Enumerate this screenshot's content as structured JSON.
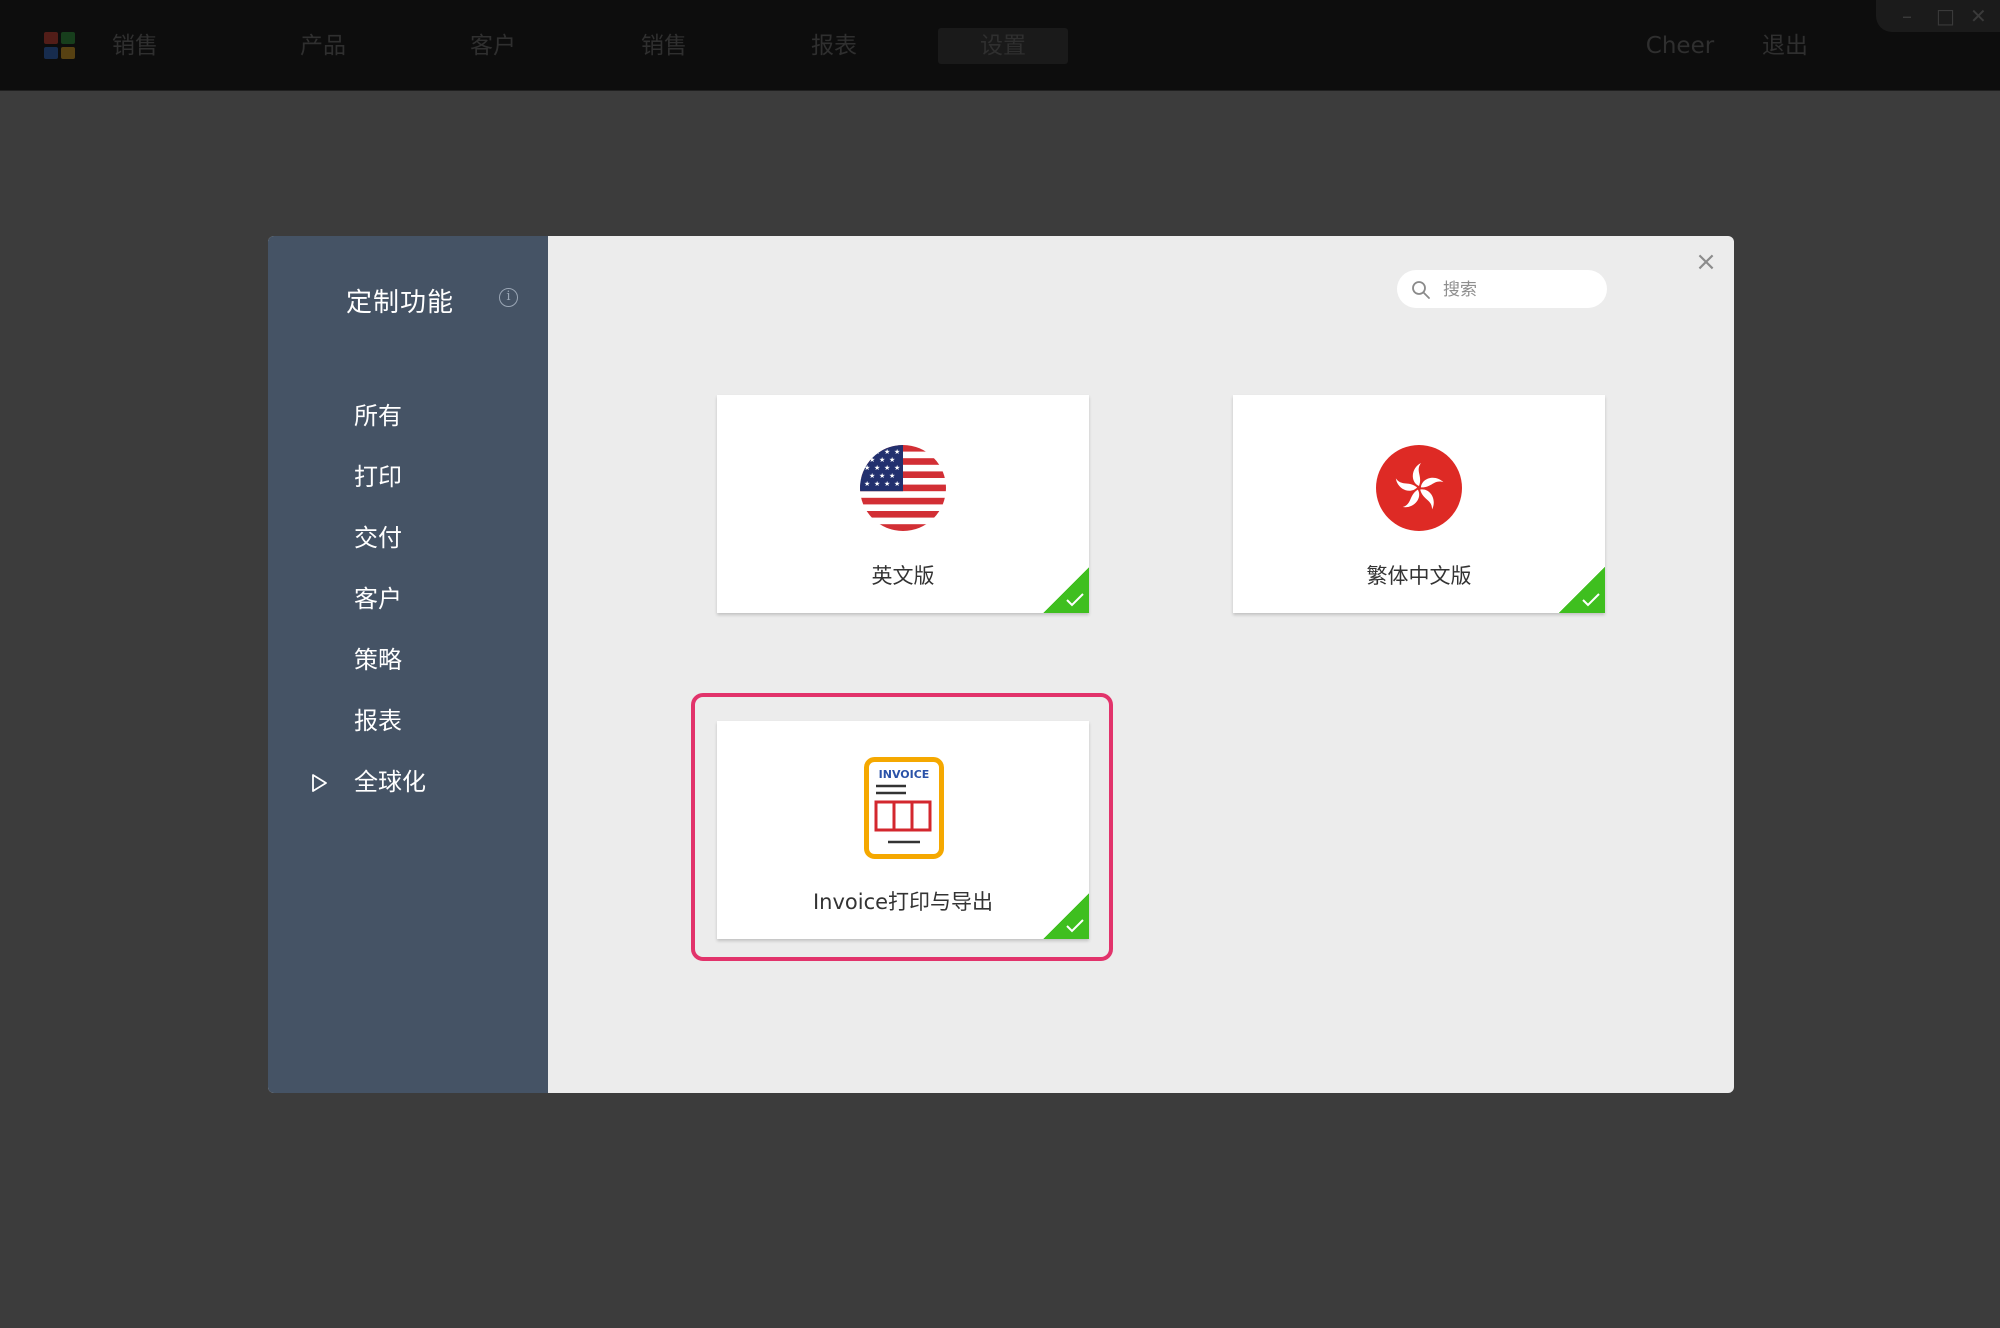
{
  "topbar": {
    "nav": [
      {
        "label": "销售"
      },
      {
        "label": "产品"
      },
      {
        "label": "客户"
      },
      {
        "label": "销售"
      },
      {
        "label": "报表"
      },
      {
        "label": "设置"
      }
    ],
    "user": "Cheer",
    "logout": "退出"
  },
  "sidebar": {
    "title": "定制功能",
    "info_icon_glyph": "i",
    "items": [
      {
        "label": "所有"
      },
      {
        "label": "打印"
      },
      {
        "label": "交付"
      },
      {
        "label": "客户"
      },
      {
        "label": "策略"
      },
      {
        "label": "报表"
      },
      {
        "label": "全球化",
        "selected": true
      }
    ]
  },
  "search": {
    "placeholder": "搜索",
    "value": ""
  },
  "close_glyph": "×",
  "cards": [
    {
      "label": "英文版",
      "icon": "us-flag-icon",
      "enabled": true
    },
    {
      "label": "繁体中文版",
      "icon": "hong-kong-flag-icon",
      "enabled": true
    },
    {
      "label": "Invoice打印与导出",
      "icon": "invoice-icon",
      "icon_text": "INVOICE",
      "enabled": true
    }
  ],
  "colors": {
    "sidebar_bg": "#455365",
    "content_bg": "#ececec",
    "check_green": "#3fbf1f",
    "highlight": "#e2336b"
  }
}
